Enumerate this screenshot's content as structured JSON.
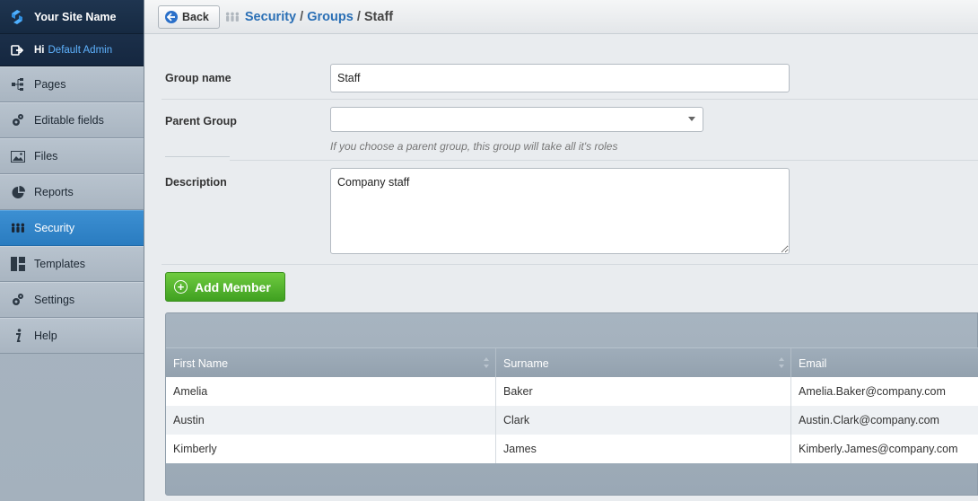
{
  "app": {
    "site_name": "Your Site Name",
    "greeting": "Hi",
    "user_name": "Default Admin"
  },
  "sidebar": {
    "items": [
      {
        "label": "Pages",
        "icon": "sitemap-icon"
      },
      {
        "label": "Editable fields",
        "icon": "gears-icon"
      },
      {
        "label": "Files",
        "icon": "image-icon"
      },
      {
        "label": "Reports",
        "icon": "pie-chart-icon"
      },
      {
        "label": "Security",
        "icon": "users-icon",
        "active": true
      },
      {
        "label": "Templates",
        "icon": "layout-icon"
      },
      {
        "label": "Settings",
        "icon": "gears-icon"
      },
      {
        "label": "Help",
        "icon": "info-icon"
      }
    ]
  },
  "topbar": {
    "back_label": "Back",
    "breadcrumb": [
      "Security",
      "Groups",
      "Staff"
    ],
    "separator": "/"
  },
  "form": {
    "group_name_label": "Group name",
    "group_name_value": "Staff",
    "parent_group_label": "Parent Group",
    "parent_group_value": "",
    "parent_group_hint": "If you choose a parent group, this group will take all it's roles",
    "description_label": "Description",
    "description_value": "Company staff"
  },
  "members": {
    "add_label": "Add Member",
    "columns": [
      "First Name",
      "Surname",
      "Email"
    ],
    "rows": [
      [
        "Amelia",
        "Baker",
        "Amelia.Baker@company.com"
      ],
      [
        "Austin",
        "Clark",
        "Austin.Clark@company.com"
      ],
      [
        "Kimberly",
        "James",
        "Kimberly.James@company.com"
      ]
    ]
  },
  "colors": {
    "accent_blue": "#2a7cc0",
    "link_blue": "#2a6fb5",
    "add_green": "#3fa020",
    "sidebar_dark": "#1f3550"
  }
}
